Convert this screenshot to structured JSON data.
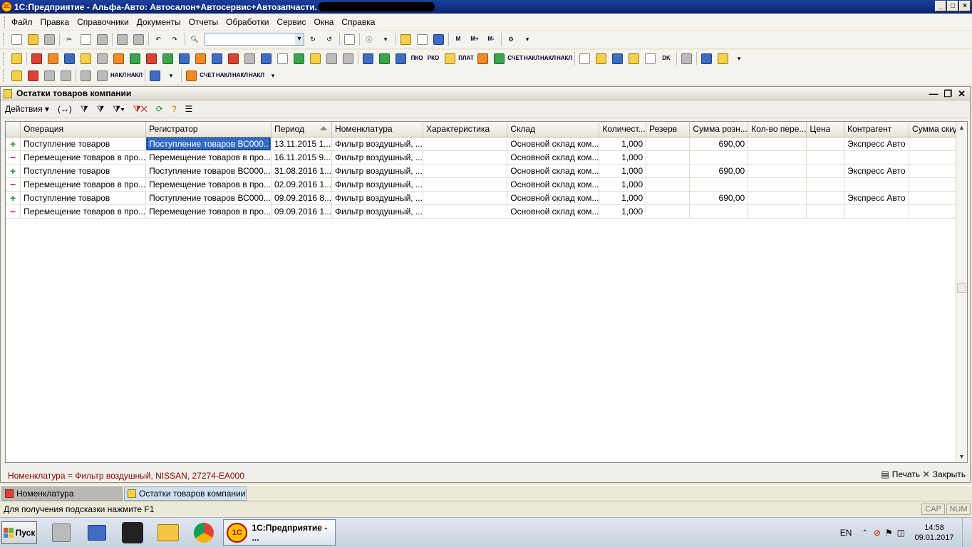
{
  "window": {
    "title": "1С:Предприятие - Альфа-Авто: Автосалон+Автосервис+Автозапчасти. ",
    "icon_text": "1С",
    "buttons": {
      "minimize": "_",
      "maximize": "□",
      "close": "×"
    }
  },
  "menu": [
    "Файл",
    "Правка",
    "Справочники",
    "Документы",
    "Отчеты",
    "Обработки",
    "Сервис",
    "Окна",
    "Справка"
  ],
  "toolbar": {
    "memory_buttons": [
      "M",
      "M+",
      "M-"
    ],
    "doc_button_labels": [
      "ПКО",
      "РКО",
      "ПЛАТ",
      "СЧЕТ",
      "НАКЛ",
      "НАКЛ",
      "НАКЛ",
      "DK"
    ],
    "doc_button_labels_row3": [
      "НАКЛ",
      "НАКЛ",
      "СЧЕТ",
      "НАКЛ",
      "НАКЛ",
      "НАКЛ"
    ]
  },
  "child_window": {
    "title": "Остатки товаров компании",
    "actions_label": "Действия",
    "columns": [
      "",
      "Операция",
      "Регистратор",
      "Период",
      "Номенклатура",
      "Характеристика",
      "Склад",
      "Количест...",
      "Резерв",
      "Сумма розн...",
      "Кол-во пере...",
      "Цена",
      "Контрагент",
      "Сумма скид..."
    ],
    "rows": [
      {
        "mark": "+",
        "op": "Поступление товаров",
        "reg": "Поступление товаров ВС000...",
        "period": "13.11.2015 1...",
        "nom": "Фильтр воздушный, ...",
        "char": "",
        "sklad": "Основной склад ком...",
        "qty": "1,000",
        "rezerv": "",
        "sum": "690,00",
        "kolvo": "",
        "price": "",
        "kontr": "Экспресс Авто",
        "disc": ""
      },
      {
        "mark": "−",
        "op": "Перемещение товаров в про...",
        "reg": "Перемещение товаров в про...",
        "period": "16.11.2015 9...",
        "nom": "Фильтр воздушный, ...",
        "char": "",
        "sklad": "Основной склад ком...",
        "qty": "1,000",
        "rezerv": "",
        "sum": "",
        "kolvo": "",
        "price": "",
        "kontr": "",
        "disc": ""
      },
      {
        "mark": "+",
        "op": "Поступление товаров",
        "reg": "Поступление товаров ВС000...",
        "period": "31.08.2016 1...",
        "nom": "Фильтр воздушный, ...",
        "char": "",
        "sklad": "Основной склад ком...",
        "qty": "1,000",
        "rezerv": "",
        "sum": "690,00",
        "kolvo": "",
        "price": "",
        "kontr": "Экспресс Авто",
        "disc": ""
      },
      {
        "mark": "−",
        "op": "Перемещение товаров в про...",
        "reg": "Перемещение товаров в про...",
        "period": "02.09.2016 1...",
        "nom": "Фильтр воздушный, ...",
        "char": "",
        "sklad": "Основной склад ком...",
        "qty": "1,000",
        "rezerv": "",
        "sum": "",
        "kolvo": "",
        "price": "",
        "kontr": "",
        "disc": ""
      },
      {
        "mark": "+",
        "op": "Поступление товаров",
        "reg": "Поступление товаров ВС000...",
        "period": "09.09.2016 8...",
        "nom": "Фильтр воздушный, ...",
        "char": "",
        "sklad": "Основной склад ком...",
        "qty": "1,000",
        "rezerv": "",
        "sum": "690,00",
        "kolvo": "",
        "price": "",
        "kontr": "Экспресс Авто",
        "disc": ""
      },
      {
        "mark": "−",
        "op": "Перемещение товаров в про...",
        "reg": "Перемещение товаров в про...",
        "period": "09.09.2016 1...",
        "nom": "Фильтр воздушный, ...",
        "char": "",
        "sklad": "Основной склад ком...",
        "qty": "1,000",
        "rezerv": "",
        "sum": "",
        "kolvo": "",
        "price": "",
        "kontr": "",
        "disc": ""
      }
    ],
    "filter_text": "Номенклатура = Фильтр воздушный, NISSAN, 27274-EA000",
    "print_label": "Печать",
    "close_label": "Закрыть"
  },
  "window_tabs": [
    "Номенклатура",
    "Остатки товаров компании"
  ],
  "status": {
    "hint": "Для получения подсказки нажмите F1",
    "cap": "CAP",
    "num": "NUM"
  },
  "taskbar": {
    "start_label": "Пуск",
    "active_task": "1С:Предприятие - ...",
    "active_task_icon_text": "1С",
    "lang": "EN",
    "time": "14:58",
    "date": "09.01.2017"
  },
  "colors": {
    "selection": "#316ac5",
    "plus": "#2e8b2e",
    "minus": "#d21a1a",
    "filter_text": "#8b0000"
  }
}
